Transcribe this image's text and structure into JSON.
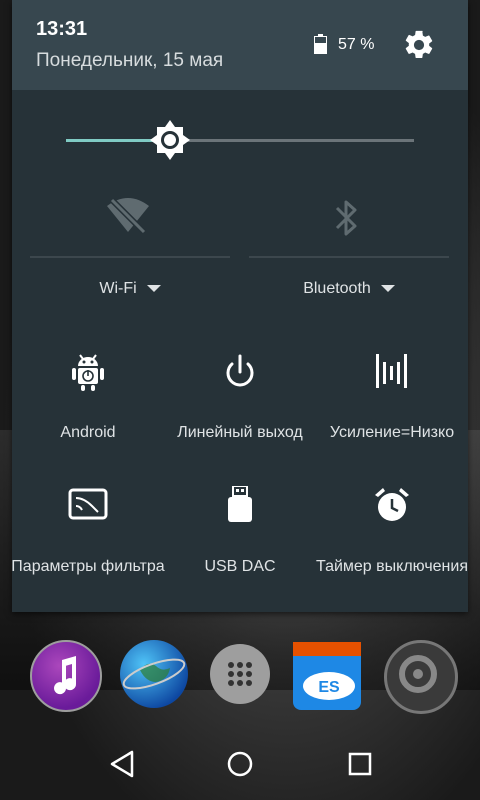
{
  "status": {
    "time": "13:31",
    "date": "Понедельник, 15 мая",
    "battery_percent": "57 %",
    "battery_level": 0.57
  },
  "brightness": {
    "level": 0.3
  },
  "toggles": {
    "wifi": {
      "label": "Wi-Fi",
      "icon": "wifi-off-icon"
    },
    "bluetooth": {
      "label": "Bluetooth",
      "icon": "bluetooth-icon"
    }
  },
  "tiles": [
    {
      "label": "Android",
      "icon": "android-icon"
    },
    {
      "label": "Линейный выход",
      "icon": "power-icon"
    },
    {
      "label": "Усиление=Низко",
      "icon": "equalizer-icon"
    },
    {
      "label": "Параметры фильтра",
      "icon": "filter-icon"
    },
    {
      "label": "USB DAC",
      "icon": "usb-icon"
    },
    {
      "label": "Таймер выключения",
      "icon": "alarm-icon"
    }
  ],
  "dock": [
    {
      "icon": "music-app-icon",
      "color": "#7b1fa2"
    },
    {
      "icon": "globe-app-icon",
      "color": "#1565c0"
    },
    {
      "icon": "app-drawer-icon",
      "color": "#8a8a8a"
    },
    {
      "icon": "es-file-explorer-icon",
      "color": "#1e88e5"
    },
    {
      "icon": "settings-app-icon",
      "color": "#444444"
    }
  ],
  "colors": {
    "shade_bg": "#263238",
    "header_bg": "#37474f",
    "accent": "#80cbc4"
  }
}
